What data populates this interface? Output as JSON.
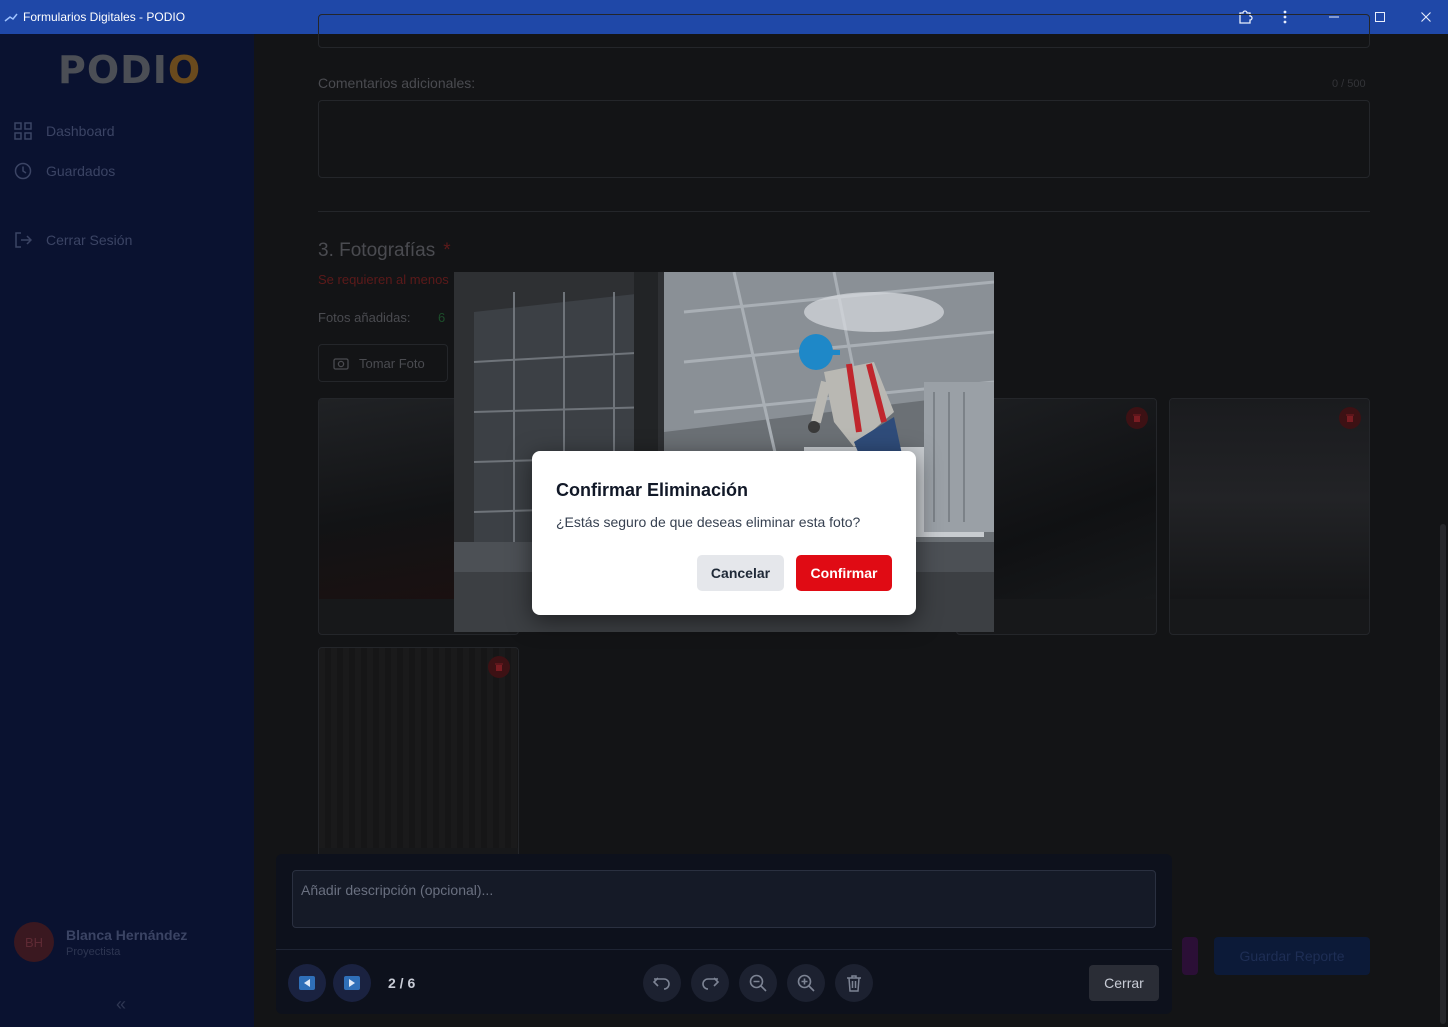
{
  "window": {
    "title": "Formularios Digitales - PODIO"
  },
  "sidebar": {
    "logo": "PODIO",
    "items": [
      {
        "label": "Dashboard",
        "icon": "grid-icon"
      },
      {
        "label": "Guardados",
        "icon": "clock-icon"
      },
      {
        "label": "Cerrar Sesión",
        "icon": "logout-icon"
      }
    ],
    "user": {
      "initials": "BH",
      "name": "Blanca Hernández",
      "role": "Proyectista"
    }
  },
  "form": {
    "comments_label": "Comentarios adicionales:",
    "comments_counter": "0 / 500",
    "section_title": "3. Fotografías",
    "required_mark": "*",
    "required_text": "Se requieren al menos",
    "photos_added_label": "Fotos añadidas:",
    "photos_added_count": "6",
    "take_photo_label": "Tomar Foto",
    "save_report_label": "Guardar Reporte"
  },
  "viewer": {
    "description_placeholder": "Añadir descripción (opcional)...",
    "counter": "2 / 6",
    "close_label": "Cerrar"
  },
  "dialog": {
    "title": "Confirmar Eliminación",
    "message": "¿Estás seguro de que deseas eliminar esta foto?",
    "cancel_label": "Cancelar",
    "confirm_label": "Confirmar"
  },
  "colors": {
    "titlebar": "#1f48a8",
    "sidebar": "#0a1230",
    "confirm": "#e00b14"
  }
}
